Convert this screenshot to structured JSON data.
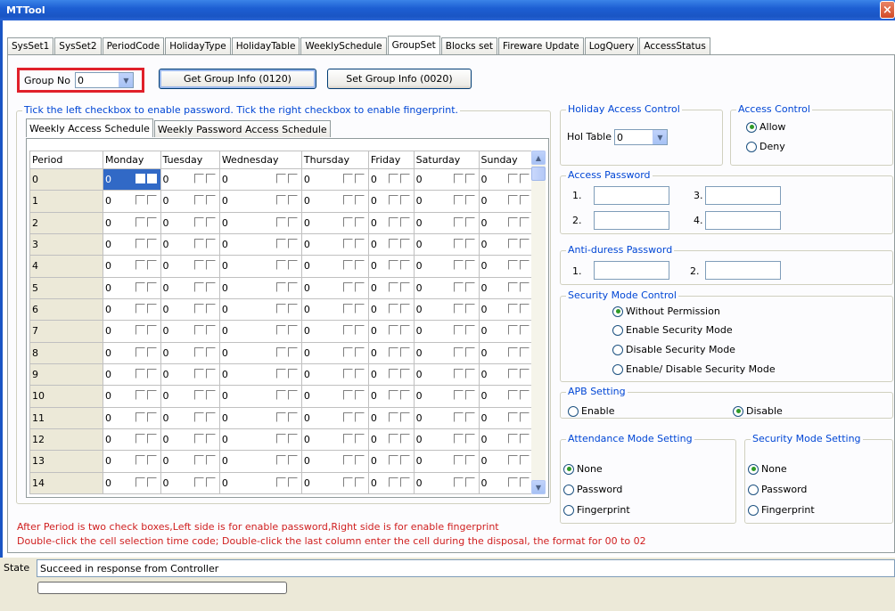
{
  "window": {
    "title": "MTTool",
    "close_glyph": "×"
  },
  "tabs": [
    "SysSet1",
    "SysSet2",
    "PeriodCode",
    "HolidayType",
    "HolidayTable",
    "WeeklySchedule",
    "GroupSet",
    "Blocks set",
    "Fireware Update",
    "LogQuery",
    "AccessStatus"
  ],
  "active_tab": "GroupSet",
  "group_no": {
    "label": "Group No",
    "value": "0"
  },
  "buttons": {
    "get": "Get Group Info (0120)",
    "set": "Set Group Info (0020)"
  },
  "instruction": "Tick the left checkbox to enable password. Tick the right checkbox to enable fingerprint.",
  "inner_tabs": [
    "Weekly Access Schedule",
    "Weekly Password Access Schedule"
  ],
  "grid": {
    "columns": [
      "Period",
      "Monday",
      "Tuesday",
      "Wednesday",
      "Thursday",
      "Friday",
      "Saturday",
      "Sunday"
    ],
    "periods": [
      "0",
      "1",
      "2",
      "3",
      "4",
      "5",
      "6",
      "7",
      "8",
      "9",
      "10",
      "11",
      "12",
      "13",
      "14"
    ],
    "cell_value": "0",
    "selected_row": 0
  },
  "holiday": {
    "legend": "Holiday Access Control",
    "label": "Hol Table",
    "value": "0"
  },
  "access_control": {
    "legend": "Access Control",
    "options": [
      "Allow",
      "Deny"
    ],
    "selected": "Allow"
  },
  "access_password": {
    "legend": "Access Password",
    "labels": [
      "1.",
      "2.",
      "3.",
      "4."
    ]
  },
  "anti_duress": {
    "legend": "Anti-duress Password",
    "labels": [
      "1.",
      "2."
    ]
  },
  "security_mode_control": {
    "legend": "Security Mode Control",
    "options": [
      "Without Permission",
      "Enable Security Mode",
      "Disable Security Mode",
      "Enable/ Disable Security Mode"
    ],
    "selected": "Without Permission"
  },
  "apb": {
    "legend": "APB Setting",
    "options": [
      "Enable",
      "Disable"
    ],
    "selected": "Disable"
  },
  "attendance_mode": {
    "legend": "Attendance Mode Setting",
    "options": [
      "None",
      "Password",
      "Fingerprint"
    ],
    "selected": "None"
  },
  "security_mode_setting": {
    "legend": "Security Mode Setting",
    "options": [
      "None",
      "Password",
      "Fingerprint"
    ],
    "selected": "None"
  },
  "notes": [
    "After Period is two check boxes,Left side is for enable password,Right side is for enable fingerprint",
    "Double-click the cell selection time code; Double-click the last column enter the cell during the disposal, the format for 00 to 02"
  ],
  "status": {
    "label": "State",
    "text": "Succeed in response from Controller",
    "progress": 0
  },
  "colors": {
    "title_bar": "#1d5fd3",
    "highlight": "#e0202a",
    "selection": "#3169c6",
    "note_text": "#d02020",
    "legend_text": "#0046d5"
  }
}
